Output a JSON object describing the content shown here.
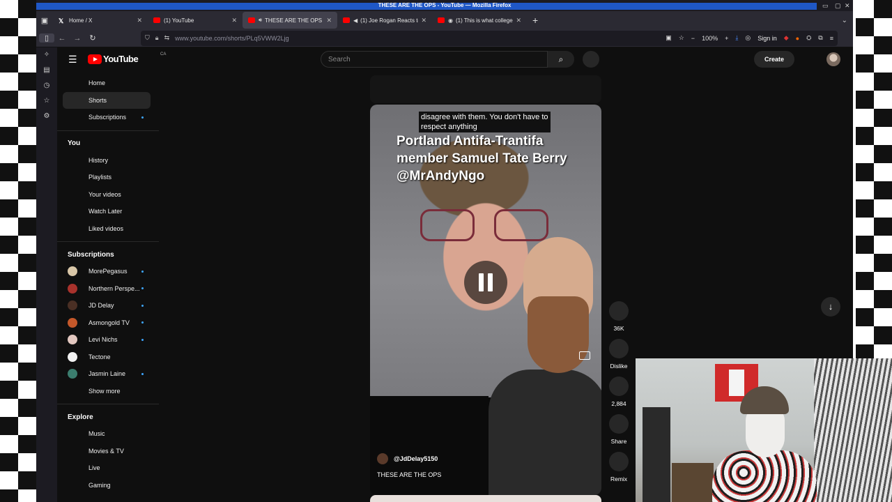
{
  "browser": {
    "window_title": "THESE ARE THE OPS - YouTube — Mozilla Firefox",
    "tabs": [
      {
        "label": "Home / X",
        "favicon": "x-icon"
      },
      {
        "label": "(1) YouTube",
        "favicon": "youtube-icon"
      },
      {
        "label": "THESE ARE THE OPS - Y",
        "favicon": "youtube-icon",
        "active": true,
        "audio": true
      },
      {
        "label": "(1) Joe Rogan Reacts to",
        "favicon": "youtube-icon",
        "audio": true
      },
      {
        "label": "(1) This is what college",
        "favicon": "youtube-icon"
      }
    ],
    "url": "www.youtube.com/shorts/PLq5VWW2Ljg",
    "zoom": "100%",
    "signin_label": "Sign in"
  },
  "youtube": {
    "logo_text": "YouTube",
    "country_code": "CA",
    "search_placeholder": "Search",
    "create_label": "Create",
    "sidebar": {
      "main": [
        {
          "label": "Home",
          "active": false
        },
        {
          "label": "Shorts",
          "active": true
        },
        {
          "label": "Subscriptions",
          "active": false,
          "dot": true
        }
      ],
      "you_heading": "You",
      "you": [
        "History",
        "Playlists",
        "Your videos",
        "Watch Later",
        "Liked videos"
      ],
      "subs_heading": "Subscriptions",
      "subscriptions": [
        {
          "label": "MorePegasus",
          "dot": true,
          "color": "#d9c7a8"
        },
        {
          "label": "Northern Perspe...",
          "dot": true,
          "color": "#a8322c"
        },
        {
          "label": "JD Delay",
          "dot": true,
          "color": "#4a2f24"
        },
        {
          "label": "Asmongold TV",
          "dot": true,
          "color": "#c5582a"
        },
        {
          "label": "Levi Nichs",
          "dot": true,
          "color": "#e3c8c0"
        },
        {
          "label": "Tectone",
          "dot": false,
          "color": "#f2f2f2"
        },
        {
          "label": "Jasmin Laine",
          "dot": true,
          "color": "#3b7d6e"
        }
      ],
      "show_more": "Show more",
      "explore_heading": "Explore",
      "explore": [
        "Music",
        "Movies & TV",
        "Live",
        "Gaming"
      ]
    },
    "short": {
      "caption_line1": "disagree with them. You don't have to",
      "caption_line2": "respect anything",
      "headline": "Portland Antifa-Trantifa member Samuel Tate Berry @MrAndyNgo",
      "channel": "@JdDelay5150",
      "title": "THESE ARE THE OPS"
    },
    "actions": [
      {
        "label": "36K",
        "name": "like-button"
      },
      {
        "label": "Dislike",
        "name": "dislike-button"
      },
      {
        "label": "2,884",
        "name": "comments-button"
      },
      {
        "label": "Share",
        "name": "share-button"
      },
      {
        "label": "Remix",
        "name": "remix-button"
      }
    ]
  }
}
